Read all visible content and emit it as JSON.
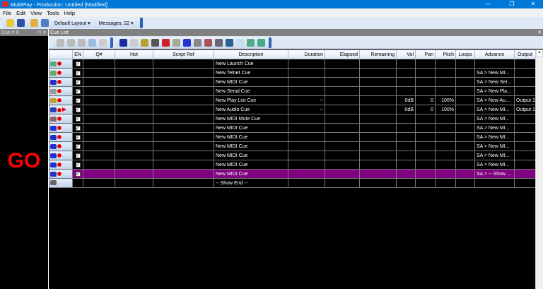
{
  "window": {
    "title": "MultiPlay - Production: Untitled [Modified]",
    "minimize": "—",
    "maximize": "❐",
    "close": "✕"
  },
  "menu": [
    "File",
    "Edit",
    "View",
    "Tools",
    "Help"
  ],
  "toolbar": {
    "layout": "Default Layout ▾",
    "messages": "Messages: 22 ▾"
  },
  "left_panel": {
    "title": "Cue # 6",
    "pin": "⊓",
    "close": "✕",
    "go": "GO"
  },
  "cue_list": {
    "title": "Cue List",
    "close": "✕",
    "columns": [
      "",
      "EN",
      "Q#",
      "Hot",
      "Script Ref",
      "Description",
      "Duration",
      "Elapsed",
      "Remaining",
      "Vol",
      "Pan",
      "Pitch",
      "Loops",
      "Advance",
      "Output"
    ],
    "rows": [
      {
        "type": "launch",
        "en": true,
        "description": "New Launch Cue",
        "duration": "",
        "vol": "",
        "pan": "",
        "pitch": "",
        "advance": "",
        "output": ""
      },
      {
        "type": "telnet",
        "en": true,
        "description": "New Telnet Cue",
        "duration": "",
        "vol": "",
        "pan": "",
        "pitch": "",
        "advance": "SA > New MI...",
        "output": ""
      },
      {
        "type": "midi",
        "en": true,
        "description": "New MIDI Cue",
        "duration": "",
        "vol": "",
        "pan": "",
        "pitch": "",
        "advance": "SA > New Ser...",
        "output": ""
      },
      {
        "type": "serial",
        "en": true,
        "description": "New Serial Cue",
        "duration": "",
        "vol": "",
        "pan": "",
        "pitch": "",
        "advance": "SA > New Pla...",
        "output": ""
      },
      {
        "type": "playlist",
        "en": true,
        "description": "New Play List Cue",
        "duration": "--",
        "vol": "0dB",
        "pan": "0",
        "pitch": "100%",
        "advance": "SA > New Au...",
        "output": "Output 1"
      },
      {
        "type": "audio",
        "en": true,
        "description": "New Audio Cue",
        "duration": "--",
        "vol": "0dB",
        "pan": "0",
        "pitch": "100%",
        "advance": "SA > New MI...",
        "output": "Output 1",
        "current": true
      },
      {
        "type": "midi-mute",
        "en": true,
        "description": "New MIDI Mute Cue",
        "duration": "",
        "vol": "",
        "pan": "",
        "pitch": "",
        "advance": "SA > New MI...",
        "output": ""
      },
      {
        "type": "midi",
        "en": true,
        "description": "New MIDI Cue",
        "duration": "",
        "vol": "",
        "pan": "",
        "pitch": "",
        "advance": "SA > New MI...",
        "output": ""
      },
      {
        "type": "midi",
        "en": true,
        "description": "New MIDI Cue",
        "duration": "",
        "vol": "",
        "pan": "",
        "pitch": "",
        "advance": "SA > New MI...",
        "output": ""
      },
      {
        "type": "midi",
        "en": true,
        "description": "New MIDI Cue",
        "duration": "",
        "vol": "",
        "pan": "",
        "pitch": "",
        "advance": "SA > New MI...",
        "output": ""
      },
      {
        "type": "midi",
        "en": true,
        "description": "New MIDI Cue",
        "duration": "",
        "vol": "",
        "pan": "",
        "pitch": "",
        "advance": "SA > New MI...",
        "output": ""
      },
      {
        "type": "midi",
        "en": true,
        "description": "New MIDI Cue",
        "duration": "",
        "vol": "",
        "pan": "",
        "pitch": "",
        "advance": "SA > New MI...",
        "output": ""
      },
      {
        "type": "midi",
        "en": true,
        "description": "New MIDI Cue",
        "duration": "",
        "vol": "",
        "pan": "",
        "pitch": "",
        "advance": "SA > -- Show ...",
        "output": "",
        "selected": true
      },
      {
        "type": "show-end",
        "en": false,
        "description": "-- Show End --",
        "duration": "",
        "vol": "",
        "pan": "",
        "pitch": "",
        "advance": "",
        "output": ""
      }
    ]
  },
  "colors": {
    "title_bar": "#0078d7",
    "selected_row": "#800080",
    "go": "#ff0000"
  }
}
